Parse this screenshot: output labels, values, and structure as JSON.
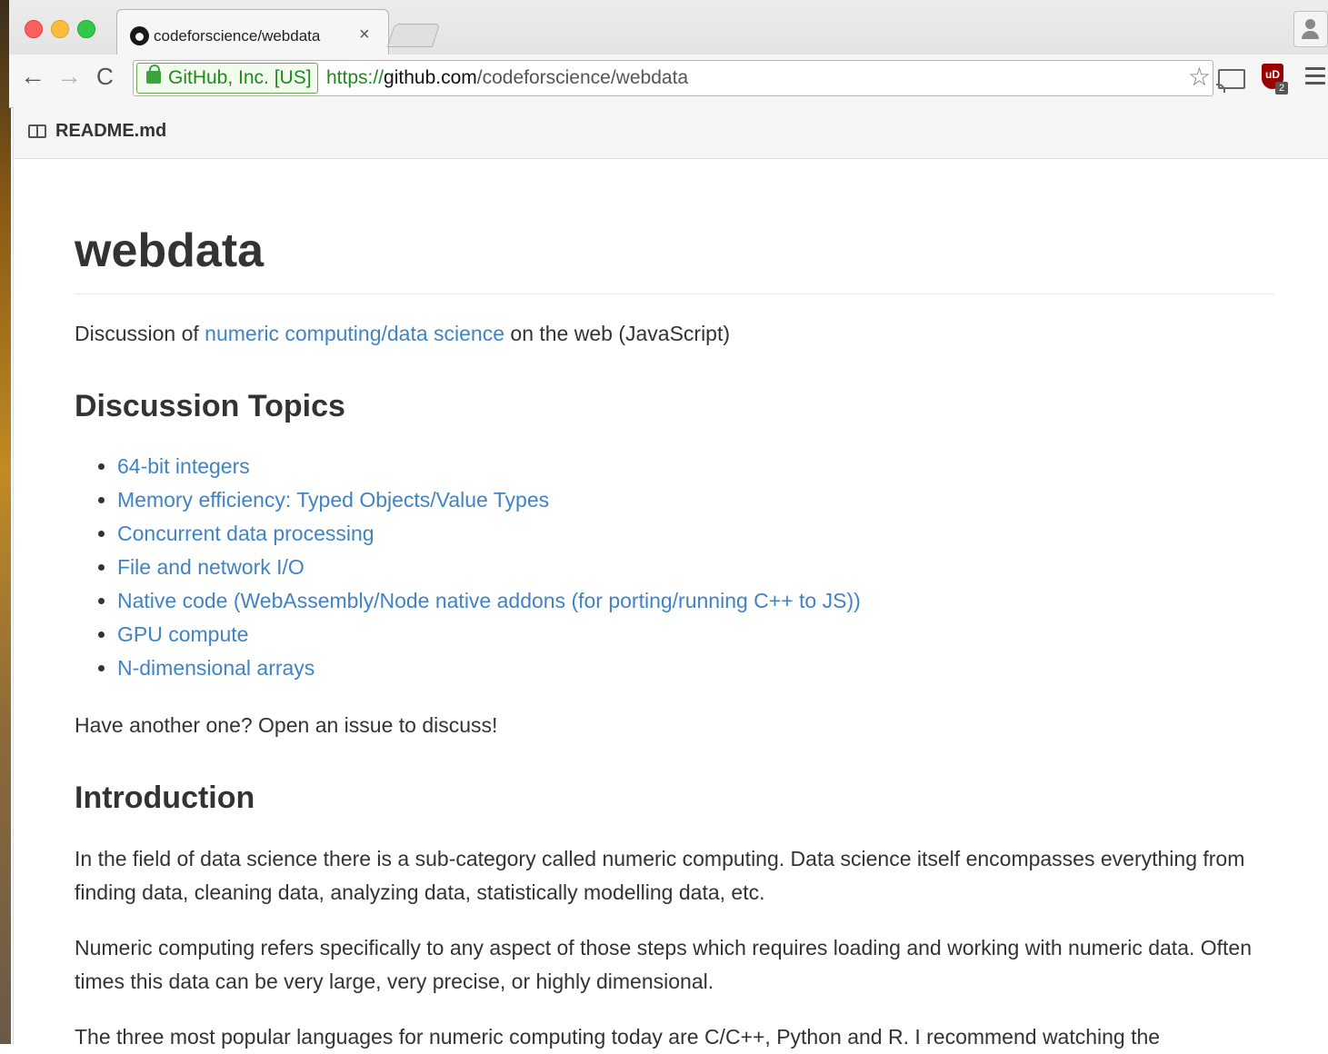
{
  "browser": {
    "tab": {
      "title": "codeforscience/webdata",
      "close": "×"
    },
    "omnibox": {
      "ev_label": "GitHub, Inc. [US]",
      "url_scheme": "https://",
      "url_host": "github.com",
      "url_path": "/codeforscience/webdata"
    },
    "nav": {
      "back": "←",
      "forward": "→",
      "reload": "C"
    },
    "extensions": {
      "ublock_mark": "uD",
      "ublock_count": "2"
    }
  },
  "readme": {
    "filename": "README.md",
    "title": "webdata",
    "intro": {
      "before": "Discussion of ",
      "link": "numeric computing/data science",
      "after": " on the web (JavaScript)"
    },
    "topics_heading": "Discussion Topics",
    "topics": [
      "64-bit integers",
      "Memory efficiency: Typed Objects/Value Types",
      "Concurrent data processing",
      "File and network I/O",
      "Native code (WebAssembly/Node native addons (for porting/running C++ to JS))",
      "GPU compute",
      "N-dimensional arrays"
    ],
    "another": "Have another one? Open an issue to discuss!",
    "introduction_heading": "Introduction",
    "paragraphs": [
      "In the field of data science there is a sub-category called numeric computing. Data science itself encompasses everything from finding data, cleaning data, analyzing data, statistically modelling data, etc.",
      "Numeric computing refers specifically to any aspect of those steps which requires loading and working with numeric data. Often times this data can be very large, very precise, or highly dimensional.",
      "The three most popular languages for numeric computing today are C/C++, Python and R. I recommend watching the"
    ]
  },
  "colors": {
    "link": "#4183c4",
    "text": "#333333",
    "ev_green": "#1e8a1e"
  }
}
